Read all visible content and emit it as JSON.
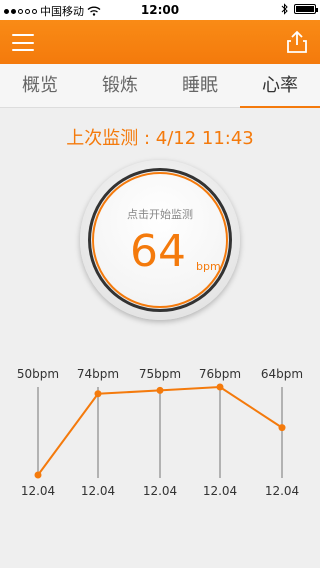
{
  "status_bar": {
    "carrier": "中国移动",
    "time": "12:00"
  },
  "tabs": [
    {
      "label": "概览",
      "active": false
    },
    {
      "label": "锻炼",
      "active": false
    },
    {
      "label": "睡眠",
      "active": false
    },
    {
      "label": "心率",
      "active": true
    }
  ],
  "last_check": "上次监测 : 4/12 11:43",
  "dial": {
    "hint": "点击开始监测",
    "value": "64",
    "unit": "bpm"
  },
  "accent_color": "#f47a0c",
  "chart_data": {
    "type": "line",
    "categories": [
      "12.04",
      "12.04",
      "12.04",
      "12.04",
      "12.04"
    ],
    "values": [
      50,
      74,
      75,
      76,
      64
    ],
    "point_labels": [
      "50bpm",
      "74bpm",
      "75bpm",
      "76bpm",
      "64bpm"
    ],
    "ylim": [
      50,
      76
    ]
  }
}
